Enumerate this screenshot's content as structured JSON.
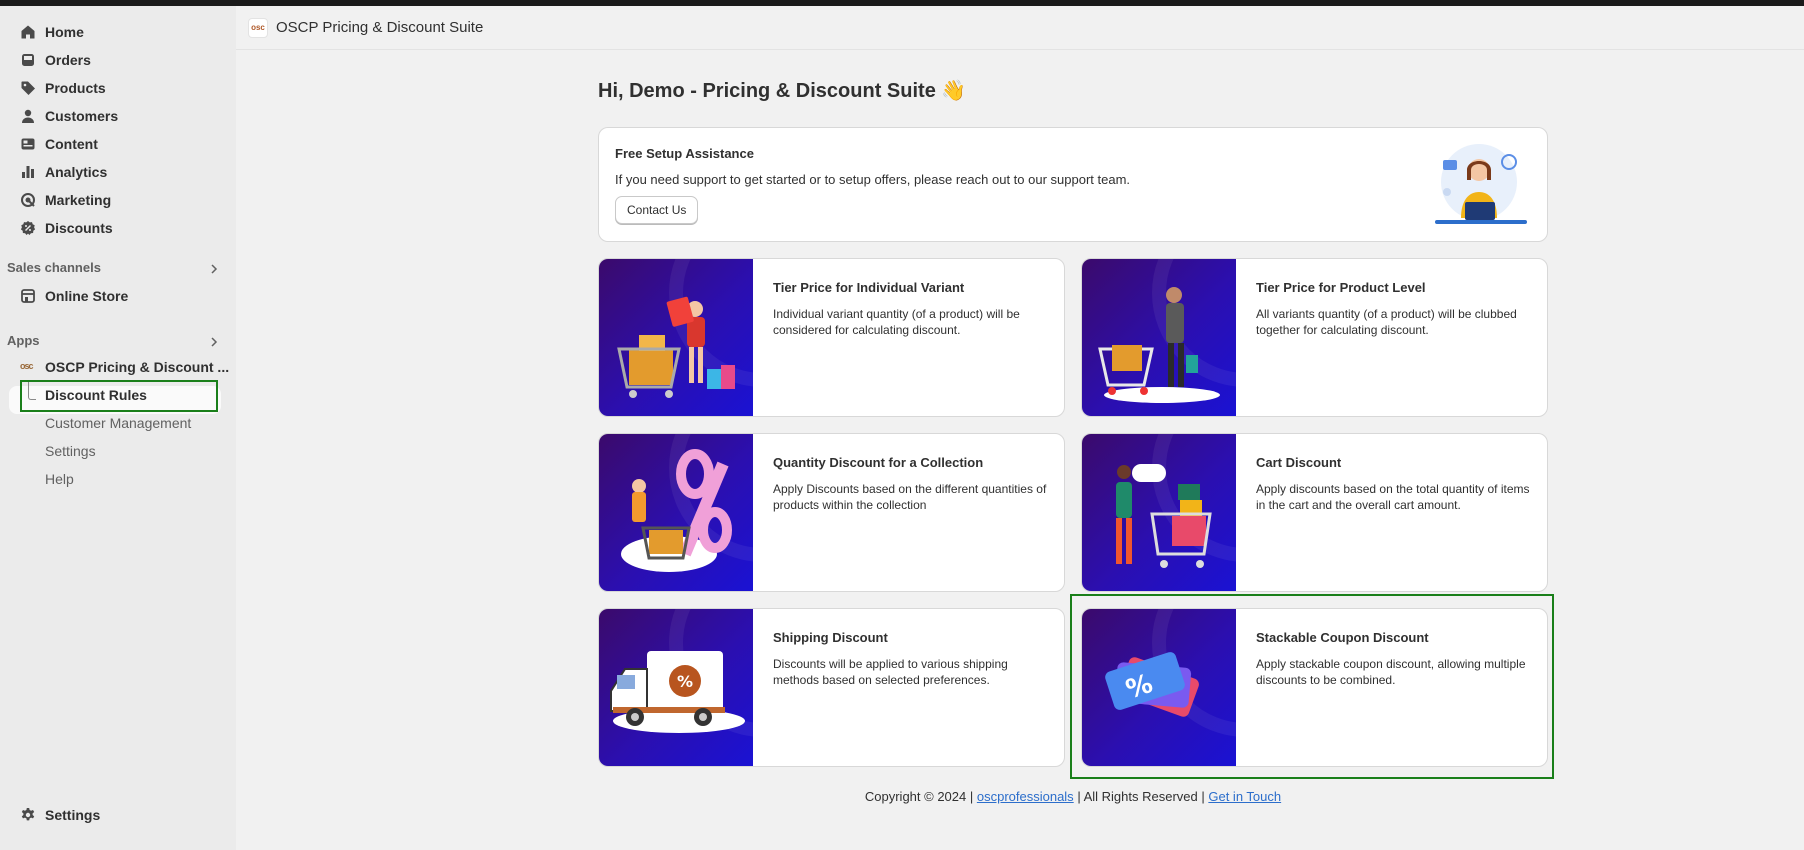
{
  "sidebar": {
    "nav": [
      {
        "label": "Home",
        "icon": "home-icon"
      },
      {
        "label": "Orders",
        "icon": "orders-icon"
      },
      {
        "label": "Products",
        "icon": "tag-icon"
      },
      {
        "label": "Customers",
        "icon": "person-icon"
      },
      {
        "label": "Content",
        "icon": "content-icon"
      },
      {
        "label": "Analytics",
        "icon": "bar-chart-icon"
      },
      {
        "label": "Marketing",
        "icon": "target-icon"
      },
      {
        "label": "Discounts",
        "icon": "discount-icon"
      }
    ],
    "sales_channels_label": "Sales channels",
    "online_store_label": "Online Store",
    "apps_label": "Apps",
    "app_name": "OSCP Pricing & Discount ...",
    "app_subitems": [
      "Discount Rules",
      "Customer Management",
      "Settings",
      "Help"
    ],
    "settings_label": "Settings"
  },
  "header": {
    "logo_text": "osc",
    "title": "OSCP Pricing & Discount Suite"
  },
  "greeting": "Hi, Demo - Pricing & Discount Suite 👋",
  "setup": {
    "title": "Free Setup Assistance",
    "description": "If you need support to get started or to setup offers, please reach out to our support team.",
    "button_label": "Contact Us"
  },
  "cards": [
    {
      "title": "Tier Price for Individual Variant",
      "description": "Individual variant quantity (of a product) will be considered for calculating discount."
    },
    {
      "title": "Tier Price for Product Level",
      "description": "All variants quantity (of a product) will be clubbed together for calculating discount."
    },
    {
      "title": "Quantity Discount for a Collection",
      "description": "Apply Discounts based on the different quantities of products within the collection"
    },
    {
      "title": "Cart Discount",
      "description": "Apply discounts based on the total quantity of items in the cart and the overall cart amount."
    },
    {
      "title": "Shipping Discount",
      "description": "Discounts will be applied to various shipping methods based on selected preferences."
    },
    {
      "title": "Stackable Coupon Discount",
      "description": "Apply stackable coupon discount, allowing multiple discounts to be combined."
    }
  ],
  "footer": {
    "copyright": "Copyright © 2024 |",
    "link1": "oscprofessionals",
    "middle": "| All Rights Reserved |",
    "link2": "Get in Touch"
  },
  "colors": {
    "highlight": "#1a7f1a",
    "link": "#2c6ecb",
    "thumb_gradient_start": "#3b0a6b",
    "thumb_gradient_end": "#1a12d4"
  }
}
